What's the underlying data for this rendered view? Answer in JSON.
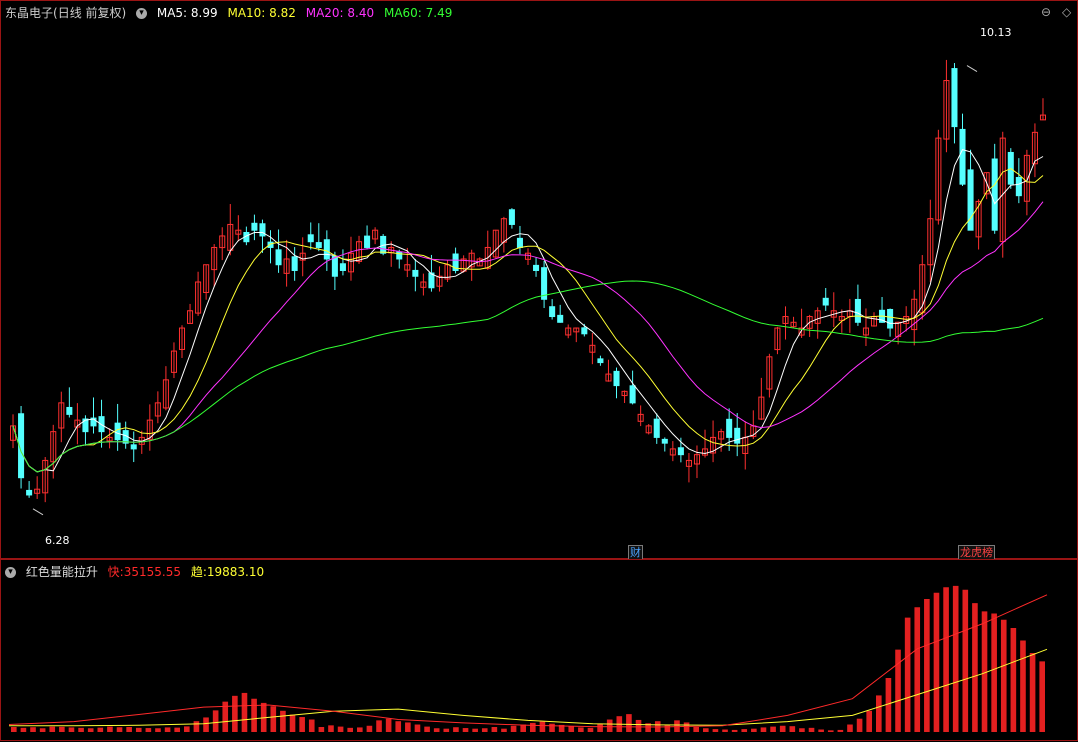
{
  "stock": {
    "name": "东晶电子",
    "period": "(日线 前复权)"
  },
  "ma_legend": [
    {
      "label": "MA5: 8.99",
      "color": "#ffffff"
    },
    {
      "label": "MA10: 8.82",
      "color": "#ffff33"
    },
    {
      "label": "MA20: 8.40",
      "color": "#ff33ff"
    },
    {
      "label": "MA60: 7.49",
      "color": "#33ff33"
    }
  ],
  "corner_icons": [
    "restore-icon",
    "diamond-icon"
  ],
  "high_label": "10.13",
  "low_label": "6.28",
  "event_tags": [
    {
      "text": "财",
      "color": "#4aa3ff"
    },
    {
      "text": "龙虎榜",
      "color": "#ff4444"
    }
  ],
  "indicator": {
    "name": "红色量能拉升",
    "fast_label": "快:",
    "fast_value": "35155.55",
    "trend_label": "趋:",
    "trend_value": "19883.10",
    "fast_color": "#ff2a2a",
    "trend_color": "#ffff33"
  },
  "colors": {
    "up": "#ff3030",
    "down": "#54ffff",
    "ma5": "#ffffff",
    "ma10": "#ffff33",
    "ma20": "#ff33ff",
    "ma60": "#33ff33",
    "volume": "#e32020",
    "fast_line": "#ff2a2a",
    "trend_line": "#ffff33"
  },
  "chart_data": {
    "type": "candlestick",
    "y_range": [
      6.0,
      10.5
    ],
    "key_prices": {
      "high": 10.13,
      "low": 6.28
    },
    "closes": [
      7.0,
      6.55,
      6.4,
      6.45,
      6.7,
      6.95,
      7.2,
      7.1,
      7.05,
      6.95,
      7.0,
      6.95,
      6.9,
      6.88,
      6.85,
      6.8,
      6.9,
      7.05,
      7.2,
      7.4,
      7.65,
      7.85,
      8.0,
      8.25,
      8.4,
      8.55,
      8.65,
      8.75,
      8.7,
      8.6,
      8.7,
      8.65,
      8.55,
      8.4,
      8.45,
      8.35,
      8.5,
      8.6,
      8.55,
      8.45,
      8.3,
      8.35,
      8.5,
      8.6,
      8.55,
      8.7,
      8.5,
      8.55,
      8.45,
      8.4,
      8.3,
      8.25,
      8.2,
      8.3,
      8.4,
      8.35,
      8.45,
      8.5,
      8.45,
      8.55,
      8.7,
      8.8,
      8.75,
      8.55,
      8.5,
      8.35,
      8.1,
      7.95,
      7.9,
      7.85,
      7.85,
      7.8,
      7.7,
      7.55,
      7.45,
      7.35,
      7.3,
      7.2,
      7.1,
      7.0,
      6.9,
      6.85,
      6.8,
      6.75,
      6.7,
      6.75,
      6.8,
      6.9,
      6.95,
      6.9,
      6.85,
      6.9,
      7.0,
      7.25,
      7.6,
      7.85,
      7.95,
      7.9,
      7.85,
      7.95,
      8.0,
      8.05,
      8.0,
      7.95,
      8.0,
      7.9,
      7.85,
      7.95,
      7.9,
      7.85,
      7.9,
      7.95,
      8.1,
      8.4,
      8.8,
      9.5,
      10.0,
      9.6,
      9.1,
      8.7,
      8.95,
      9.2,
      8.7,
      9.5,
      9.1,
      9.0,
      9.35,
      9.55,
      9.7
    ]
  },
  "indicator_data": {
    "type": "bar+line",
    "fast": [
      1200,
      1000,
      1150,
      900,
      1300,
      1250,
      1100,
      1000,
      900,
      1050,
      1300,
      1150,
      1200,
      1000,
      950,
      900,
      1100,
      1050,
      1350,
      2600,
      3500,
      5200,
      7300,
      8700,
      9400,
      8000,
      7000,
      6200,
      5100,
      4200,
      3600,
      3000,
      1200,
      1600,
      1300,
      1000,
      1100,
      1500,
      2800,
      3200,
      2600,
      2300,
      1800,
      1300,
      900,
      800,
      1150,
      950,
      800,
      900,
      1200,
      800,
      1500,
      1800,
      2200,
      2500,
      2000,
      1700,
      1400,
      1100,
      1000,
      2000,
      3000,
      3800,
      4300,
      2900,
      2100,
      2600,
      1600,
      2800,
      2300,
      1200,
      900,
      700,
      600,
      500,
      700,
      800,
      1100,
      1300,
      1500,
      1400,
      900,
      1000,
      600,
      400,
      500,
      1800,
      3200,
      5100,
      8800,
      13000,
      19800,
      27500,
      30000,
      32000,
      33500,
      34800,
      35155.55,
      34200,
      31000,
      29000,
      28500,
      27000,
      25000,
      22000,
      19000,
      17000
    ],
    "fast_curve": [
      1800,
      2500,
      4200,
      6000,
      6500,
      5000,
      3000,
      2200,
      1600,
      1300,
      1200,
      1500,
      4000,
      8000,
      20000,
      26000,
      33000
    ],
    "trend_curve": [
      1500,
      1500,
      1600,
      2000,
      3500,
      5000,
      5500,
      4000,
      2800,
      2000,
      1700,
      1600,
      2500,
      4000,
      9000,
      14000,
      19883.1
    ],
    "fast_range": [
      0,
      38000
    ]
  }
}
